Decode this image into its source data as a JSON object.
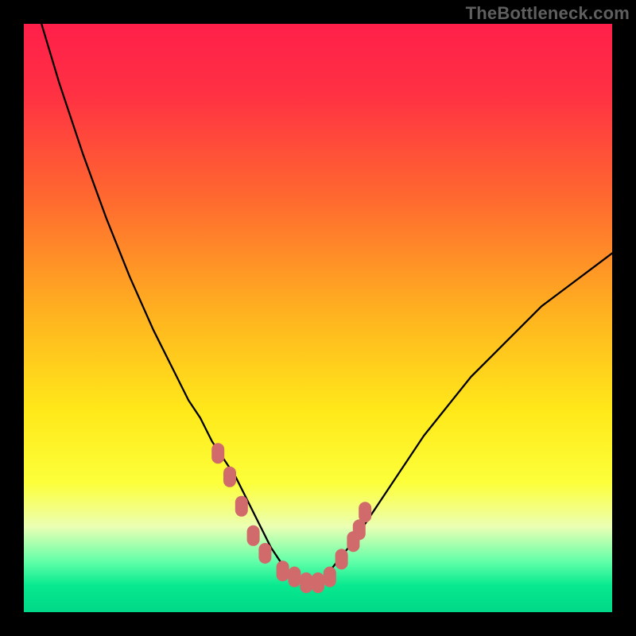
{
  "watermark": "TheBottleneck.com",
  "colors": {
    "frame": "#000000",
    "gradient_stops": [
      {
        "offset": 0.0,
        "color": "#ff1f4a"
      },
      {
        "offset": 0.12,
        "color": "#ff3143"
      },
      {
        "offset": 0.3,
        "color": "#ff6a2f"
      },
      {
        "offset": 0.5,
        "color": "#ffb51f"
      },
      {
        "offset": 0.66,
        "color": "#ffe91a"
      },
      {
        "offset": 0.78,
        "color": "#fcff3a"
      },
      {
        "offset": 0.82,
        "color": "#f5ff7a"
      },
      {
        "offset": 0.855,
        "color": "#eaffb4"
      },
      {
        "offset": 0.915,
        "color": "#5fffa8"
      },
      {
        "offset": 0.955,
        "color": "#07e98f"
      },
      {
        "offset": 1.0,
        "color": "#00d887"
      }
    ],
    "curve": "#000000",
    "markers": "#d16a6a"
  },
  "chart_data": {
    "type": "line",
    "title": "",
    "xlabel": "",
    "ylabel": "",
    "xlim": [
      0,
      100
    ],
    "ylim": [
      0,
      100
    ],
    "grid": false,
    "legend": false,
    "annotations": [],
    "series": [
      {
        "name": "curve",
        "x": [
          3,
          6,
          10,
          14,
          18,
          22,
          26,
          28,
          30,
          32,
          34,
          36,
          38,
          40,
          42,
          44,
          46,
          48,
          50,
          52,
          56,
          60,
          64,
          68,
          72,
          76,
          80,
          84,
          88,
          92,
          96,
          100
        ],
        "y": [
          100,
          90,
          78,
          67,
          57,
          48,
          40,
          36,
          33,
          29,
          26,
          23,
          19,
          15,
          11,
          8,
          6,
          5,
          5,
          7,
          12,
          18,
          24,
          30,
          35,
          40,
          44,
          48,
          52,
          55,
          58,
          61
        ]
      }
    ],
    "markers": [
      {
        "x": 33,
        "y": 27
      },
      {
        "x": 35,
        "y": 23
      },
      {
        "x": 37,
        "y": 18
      },
      {
        "x": 39,
        "y": 13
      },
      {
        "x": 41,
        "y": 10
      },
      {
        "x": 44,
        "y": 7
      },
      {
        "x": 46,
        "y": 6
      },
      {
        "x": 48,
        "y": 5
      },
      {
        "x": 50,
        "y": 5
      },
      {
        "x": 52,
        "y": 6
      },
      {
        "x": 54,
        "y": 9
      },
      {
        "x": 56,
        "y": 12
      },
      {
        "x": 57,
        "y": 14
      },
      {
        "x": 58,
        "y": 17
      }
    ]
  }
}
